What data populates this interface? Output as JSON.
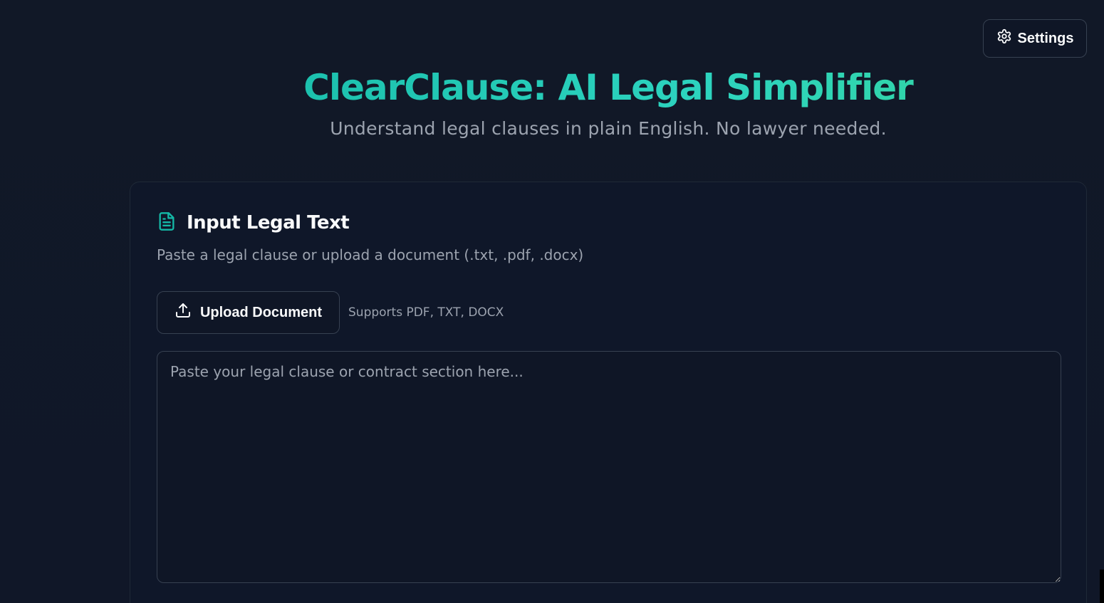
{
  "settings": {
    "label": "Settings",
    "icon": "gear-icon"
  },
  "header": {
    "title": "ClearClause: AI Legal Simplifier",
    "subtitle": "Understand legal clauses in plain English. No lawyer needed."
  },
  "input_card": {
    "icon": "document-icon",
    "title": "Input Legal Text",
    "description": "Paste a legal clause or upload a document (.txt, .pdf, .docx)",
    "upload_button": {
      "label": "Upload Document",
      "icon": "upload-icon"
    },
    "upload_hint": "Supports PDF, TXT, DOCX",
    "textarea": {
      "value": "",
      "placeholder": "Paste your legal clause or contract section here..."
    }
  },
  "colors": {
    "background": "#111827",
    "accent": "#14b8a6",
    "accent_light": "#2dd4bf",
    "muted_text": "#9ca3af",
    "border": "#374151"
  }
}
